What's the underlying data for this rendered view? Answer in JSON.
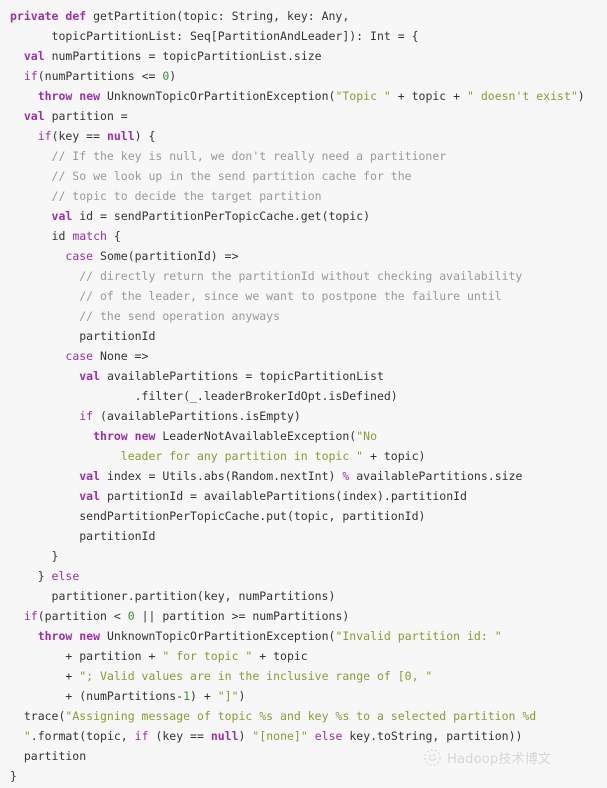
{
  "editor": {
    "language": "Scala",
    "background_color": "#f7f7f7",
    "default_text_color": "#333333",
    "colors": {
      "keyword": "#9b30a8",
      "string": "#8a9a35",
      "number": "#3b8a3b",
      "comment": "#999999",
      "operator": "#9b30a8",
      "plain": "#333333"
    }
  },
  "code": {
    "lines": [
      [
        {
          "t": "private",
          "c": "kwb"
        },
        {
          "t": " ",
          "c": "plain"
        },
        {
          "t": "def",
          "c": "kwb"
        },
        {
          "t": " getPartition(topic: String, key: Any,",
          "c": "plain"
        }
      ],
      [
        {
          "t": "      topicPartitionList: Seq[PartitionAndLeader]): Int = {",
          "c": "plain"
        }
      ],
      [
        {
          "t": "  ",
          "c": "plain"
        },
        {
          "t": "val",
          "c": "kwb"
        },
        {
          "t": " numPartitions = topicPartitionList.size",
          "c": "plain"
        }
      ],
      [
        {
          "t": "  ",
          "c": "plain"
        },
        {
          "t": "if",
          "c": "kw"
        },
        {
          "t": "(numPartitions <= ",
          "c": "plain"
        },
        {
          "t": "0",
          "c": "num"
        },
        {
          "t": ")",
          "c": "plain"
        }
      ],
      [
        {
          "t": "    ",
          "c": "plain"
        },
        {
          "t": "throw",
          "c": "kwb"
        },
        {
          "t": " ",
          "c": "plain"
        },
        {
          "t": "new",
          "c": "kwb"
        },
        {
          "t": " UnknownTopicOrPartitionException(",
          "c": "plain"
        },
        {
          "t": "\"Topic \"",
          "c": "str"
        },
        {
          "t": " + topic + ",
          "c": "plain"
        },
        {
          "t": "\" doesn't exist\"",
          "c": "str"
        },
        {
          "t": ")",
          "c": "plain"
        }
      ],
      [
        {
          "t": "  ",
          "c": "plain"
        },
        {
          "t": "val",
          "c": "kwb"
        },
        {
          "t": " partition =",
          "c": "plain"
        }
      ],
      [
        {
          "t": "    ",
          "c": "plain"
        },
        {
          "t": "if",
          "c": "kw"
        },
        {
          "t": "(key == ",
          "c": "plain"
        },
        {
          "t": "null",
          "c": "kwb"
        },
        {
          "t": ") {",
          "c": "plain"
        }
      ],
      [
        {
          "t": "      // If the key is null, we don't really need a partitioner",
          "c": "com"
        }
      ],
      [
        {
          "t": "      // So we look up in the send partition cache for the",
          "c": "com"
        }
      ],
      [
        {
          "t": "      // topic to decide the target partition",
          "c": "com"
        }
      ],
      [
        {
          "t": "      ",
          "c": "plain"
        },
        {
          "t": "val",
          "c": "kwb"
        },
        {
          "t": " id = sendPartitionPerTopicCache.get(topic)",
          "c": "plain"
        }
      ],
      [
        {
          "t": "      id ",
          "c": "plain"
        },
        {
          "t": "match",
          "c": "kw"
        },
        {
          "t": " {",
          "c": "plain"
        }
      ],
      [
        {
          "t": "        ",
          "c": "plain"
        },
        {
          "t": "case",
          "c": "kw"
        },
        {
          "t": " Some(partitionId) =>",
          "c": "plain"
        }
      ],
      [
        {
          "t": "          // directly return the partitionId without checking availability",
          "c": "com"
        }
      ],
      [
        {
          "t": "          // of the leader, since we want to postpone the failure until",
          "c": "com"
        }
      ],
      [
        {
          "t": "          // the send operation anyways",
          "c": "com"
        }
      ],
      [
        {
          "t": "          partitionId",
          "c": "plain"
        }
      ],
      [
        {
          "t": "        ",
          "c": "plain"
        },
        {
          "t": "case",
          "c": "kw"
        },
        {
          "t": " None =>",
          "c": "plain"
        }
      ],
      [
        {
          "t": "          ",
          "c": "plain"
        },
        {
          "t": "val",
          "c": "kwb"
        },
        {
          "t": " availablePartitions = topicPartitionList",
          "c": "plain"
        }
      ],
      [
        {
          "t": "                  .filter(_.leaderBrokerIdOpt.isDefined)",
          "c": "plain"
        }
      ],
      [
        {
          "t": "          ",
          "c": "plain"
        },
        {
          "t": "if",
          "c": "kw"
        },
        {
          "t": " (availablePartitions.isEmpty)",
          "c": "plain"
        }
      ],
      [
        {
          "t": "            ",
          "c": "plain"
        },
        {
          "t": "throw",
          "c": "kwb"
        },
        {
          "t": " ",
          "c": "plain"
        },
        {
          "t": "new",
          "c": "kwb"
        },
        {
          "t": " LeaderNotAvailableException(",
          "c": "plain"
        },
        {
          "t": "\"No",
          "c": "str"
        }
      ],
      [
        {
          "t": "                ",
          "c": "plain"
        },
        {
          "t": "leader for any partition in topic \"",
          "c": "str"
        },
        {
          "t": " + topic)",
          "c": "plain"
        }
      ],
      [
        {
          "t": "          ",
          "c": "plain"
        },
        {
          "t": "val",
          "c": "kwb"
        },
        {
          "t": " index = Utils.abs(Random.nextInt) ",
          "c": "plain"
        },
        {
          "t": "%",
          "c": "op"
        },
        {
          "t": " availablePartitions.size",
          "c": "plain"
        }
      ],
      [
        {
          "t": "          ",
          "c": "plain"
        },
        {
          "t": "val",
          "c": "kwb"
        },
        {
          "t": " partitionId = availablePartitions(index).partitionId",
          "c": "plain"
        }
      ],
      [
        {
          "t": "          sendPartitionPerTopicCache.put(topic, partitionId)",
          "c": "plain"
        }
      ],
      [
        {
          "t": "          partitionId",
          "c": "plain"
        }
      ],
      [
        {
          "t": "      }",
          "c": "plain"
        }
      ],
      [
        {
          "t": "    } ",
          "c": "plain"
        },
        {
          "t": "else",
          "c": "kw"
        }
      ],
      [
        {
          "t": "      partitioner.partition(key, numPartitions)",
          "c": "plain"
        }
      ],
      [
        {
          "t": "  ",
          "c": "plain"
        },
        {
          "t": "if",
          "c": "kw"
        },
        {
          "t": "(partition < ",
          "c": "plain"
        },
        {
          "t": "0",
          "c": "num"
        },
        {
          "t": " || partition >= numPartitions)",
          "c": "plain"
        }
      ],
      [
        {
          "t": "    ",
          "c": "plain"
        },
        {
          "t": "throw",
          "c": "kwb"
        },
        {
          "t": " ",
          "c": "plain"
        },
        {
          "t": "new",
          "c": "kwb"
        },
        {
          "t": " UnknownTopicOrPartitionException(",
          "c": "plain"
        },
        {
          "t": "\"Invalid partition id: \"",
          "c": "str"
        }
      ],
      [
        {
          "t": "        + partition + ",
          "c": "plain"
        },
        {
          "t": "\" for topic \"",
          "c": "str"
        },
        {
          "t": " + topic",
          "c": "plain"
        }
      ],
      [
        {
          "t": "        + ",
          "c": "plain"
        },
        {
          "t": "\"; Valid values are in the inclusive range of [0, \"",
          "c": "str"
        }
      ],
      [
        {
          "t": "        + (numPartitions-",
          "c": "plain"
        },
        {
          "t": "1",
          "c": "num"
        },
        {
          "t": ") + ",
          "c": "plain"
        },
        {
          "t": "\"]\"",
          "c": "str"
        },
        {
          "t": ")",
          "c": "plain"
        }
      ],
      [
        {
          "t": "  trace(",
          "c": "plain"
        },
        {
          "t": "\"Assigning message of topic %s and key %s to a selected partition %d",
          "c": "str"
        }
      ],
      [
        {
          "t": "  ",
          "c": "plain"
        },
        {
          "t": "\"",
          "c": "str"
        },
        {
          "t": ".format(topic, ",
          "c": "plain"
        },
        {
          "t": "if",
          "c": "kw"
        },
        {
          "t": " (key == ",
          "c": "plain"
        },
        {
          "t": "null",
          "c": "kwb"
        },
        {
          "t": ") ",
          "c": "plain"
        },
        {
          "t": "\"[none]\"",
          "c": "str"
        },
        {
          "t": " ",
          "c": "plain"
        },
        {
          "t": "else",
          "c": "kw"
        },
        {
          "t": " key.toString, partition))",
          "c": "plain"
        }
      ],
      [
        {
          "t": "  partition",
          "c": "plain"
        }
      ],
      [
        {
          "t": "}",
          "c": "plain"
        }
      ]
    ]
  },
  "watermark": {
    "text": "Hadoop技术博文",
    "logo_icon": "wechat-camera-icon",
    "color": "#8b8b8b"
  }
}
